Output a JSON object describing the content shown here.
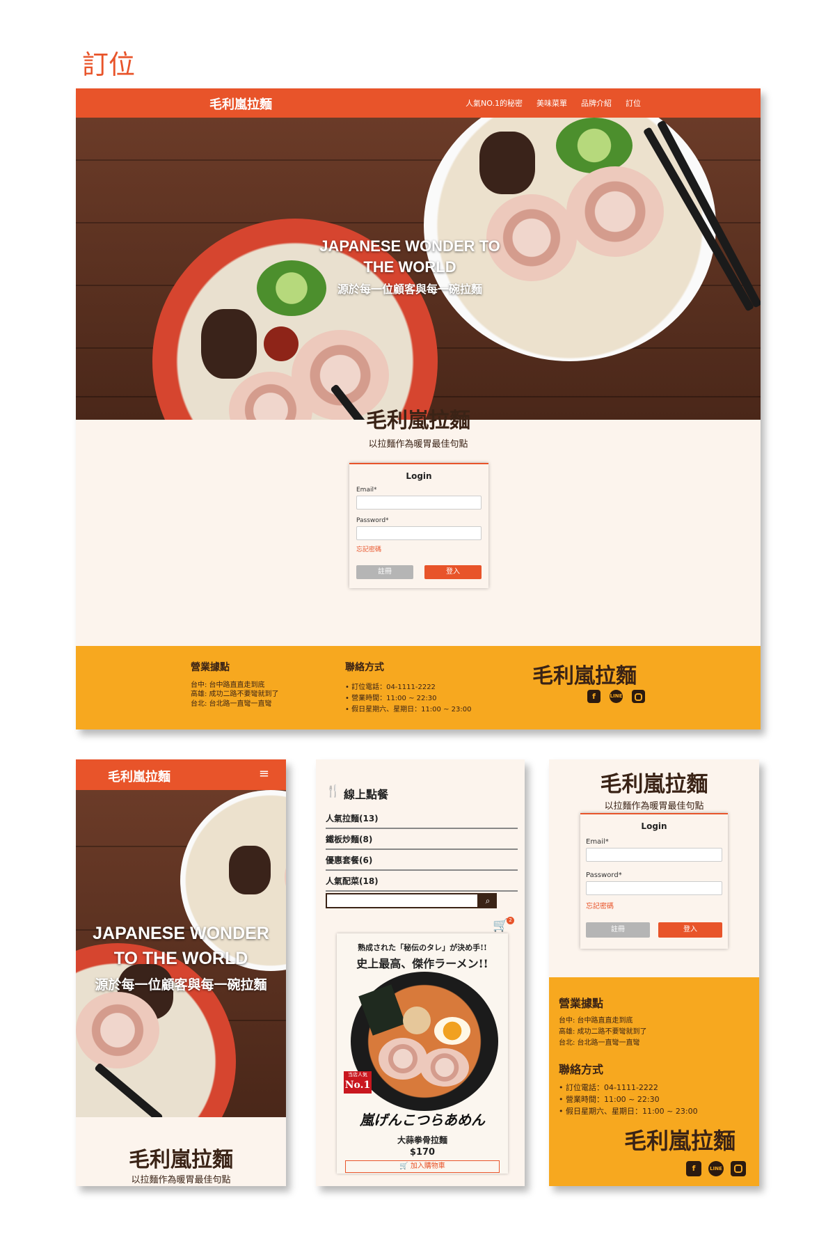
{
  "page_label": "訂位",
  "brand": "毛利嵐拉麵",
  "nav": [
    "人氣NO.1的秘密",
    "美味菜單",
    "品牌介紹",
    "訂位"
  ],
  "hero": {
    "title_line1": "JAPANESE WONDER TO",
    "title_line2": "THE WORLD",
    "mobile_title_line1": "JAPANESE WONDER",
    "mobile_title_line2": "TO THE WORLD",
    "subtitle": "源於每一位顧客與每一碗拉麵"
  },
  "tagline": "以拉麵作為暖胃最佳句點",
  "login": {
    "title": "Login",
    "email_label": "Email*",
    "password_label": "Password*",
    "forgot": "忘記密碼",
    "register": "註冊",
    "submit": "登入"
  },
  "footer": {
    "locations_title": "營業據點",
    "locations": [
      "台中: 台中路直直走到底",
      "高雄: 成功二路不要彎就到了",
      "台北: 台北路一直彎一直彎"
    ],
    "contact_title": "聯絡方式",
    "contact": [
      "• 訂位電話：04-1111-2222",
      "• 營業時間：11:00 ~ 22:30",
      "• 假日星期六、星期日：11:00 ~ 23:00"
    ],
    "social": [
      "facebook-icon",
      "line-icon",
      "instagram-icon"
    ]
  },
  "mobile_menu_icon": "≡",
  "order": {
    "title": "線上點餐",
    "categories": [
      "人氣拉麵(13)",
      "鐵板炒麵(8)",
      "優惠套餐(6)",
      "人氣配菜(18)"
    ],
    "cart_count": "2",
    "poster_line1": "熟成された「秘伝のタレ」が決め手!!",
    "poster_line2": "史上最高、傑作ラーメン!!",
    "poster_badge_small": "当店人気",
    "poster_badge": "No.1",
    "poster_brand": "嵐げんこつらあめん",
    "item_name": "大蒜拳骨拉麵",
    "item_price": "$170",
    "add_to_cart": "加入購物車"
  },
  "colors": {
    "accent": "#e8542a",
    "footer": "#f7a81f",
    "bg": "#fcf4ed",
    "text": "#3a2316"
  }
}
